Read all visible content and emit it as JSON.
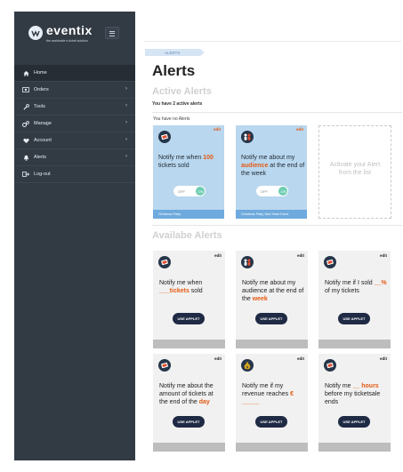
{
  "brand": {
    "name": "eventix",
    "tagline": "the worldwide e-ticket solution"
  },
  "sidebar": {
    "items": [
      {
        "label": "Home",
        "icon": "home-icon",
        "active": true,
        "has_submenu": false
      },
      {
        "label": "Orders",
        "icon": "orders-icon",
        "active": false,
        "has_submenu": true
      },
      {
        "label": "Tools",
        "icon": "wrench-icon",
        "active": false,
        "has_submenu": true
      },
      {
        "label": "Manage",
        "icon": "gears-icon",
        "active": false,
        "has_submenu": true
      },
      {
        "label": "Account",
        "icon": "heart-icon",
        "active": false,
        "has_submenu": true
      },
      {
        "label": "Alerts",
        "icon": "bell-icon",
        "active": false,
        "has_submenu": true
      },
      {
        "label": "Log-out",
        "icon": "logout-icon",
        "active": false,
        "has_submenu": false
      }
    ]
  },
  "breadcrumb": "ALERTS",
  "page_title": "Alerts",
  "active": {
    "title": "Active Alerts",
    "count_text": "You have 2 active alerts",
    "empty_note": "You have no Alerts",
    "cards": [
      {
        "icon": "ticket-icon",
        "edit": "edit",
        "pre": "Notify me when ",
        "hl": "100",
        "post": " tickets sold",
        "toggle_off": "OFF",
        "toggle_on": "ON",
        "footer": "Christmas Party"
      },
      {
        "icon": "people-icon",
        "edit": "edit",
        "pre": "Notify me about my ",
        "hl": "audience",
        "post": " at the end of the week",
        "toggle_off": "OFF",
        "toggle_on": "ON",
        "footer": "Christmas Party, New Years Event"
      }
    ],
    "placeholder": "Activate your Alert from the list"
  },
  "available": {
    "title": "Availabe Alerts",
    "button_label": "USE APPLET",
    "cards": [
      {
        "icon": "ticket-icon",
        "edit": "edit",
        "pre": "Notify me when ",
        "hl": "___tickets",
        "post": " sold"
      },
      {
        "icon": "people-icon",
        "edit": "edit",
        "pre": "Notify me about my audience at the end of the ",
        "hl": "week",
        "post": ""
      },
      {
        "icon": "ticket-icon",
        "edit": "edit",
        "pre": "Notify me if I sold ",
        "hl": "__%",
        "post": " of my tickets"
      },
      {
        "icon": "ticket-icon",
        "edit": "edit",
        "pre": "Notify me about the amount of tickets at the end of the ",
        "hl": "day",
        "post": ""
      },
      {
        "icon": "money-bag-icon",
        "edit": "edit",
        "pre": "Notify me if my revenue reaches ",
        "hl": "€ _____",
        "post": ""
      },
      {
        "icon": "ticket-icon",
        "edit": "edit",
        "pre": "Notify me ",
        "hl": "__ hours",
        "post": " before my ticketsale ends"
      }
    ]
  },
  "colors": {
    "sidebar_bg": "#323a44",
    "accent": "#e55a13",
    "active_card_bg": "#b9d7ee",
    "active_card_footer": "#6eaadd",
    "button_bg": "#1f2a44",
    "toggle_on": "#6fcdb2"
  }
}
